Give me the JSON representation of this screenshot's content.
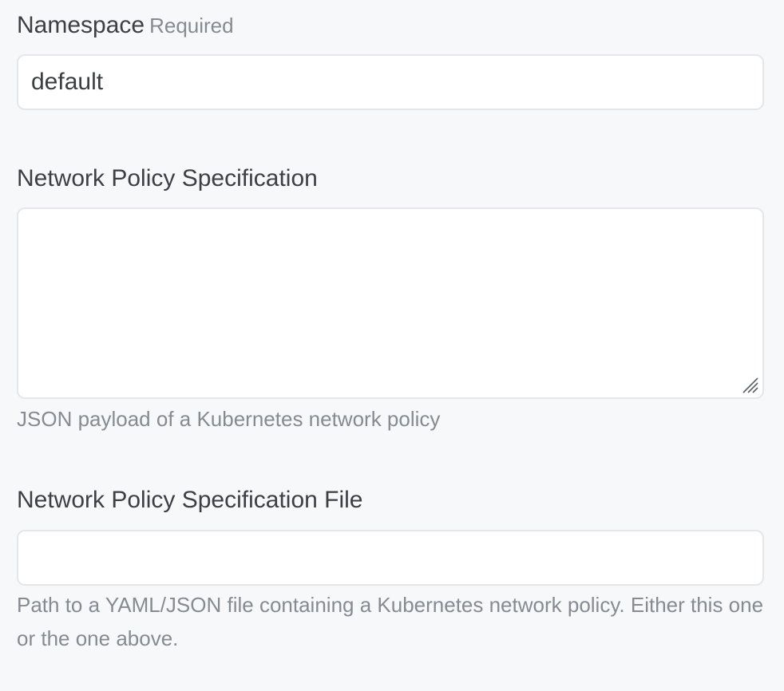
{
  "namespace": {
    "label": "Namespace",
    "required_tag": "Required",
    "value": "default"
  },
  "spec": {
    "label": "Network Policy Specification",
    "value": "",
    "help": "JSON payload of a Kubernetes network policy"
  },
  "spec_file": {
    "label": "Network Policy Specification File",
    "value": "",
    "help": "Path to a YAML/JSON file containing a Kubernetes network policy. Either this one or the one above."
  }
}
